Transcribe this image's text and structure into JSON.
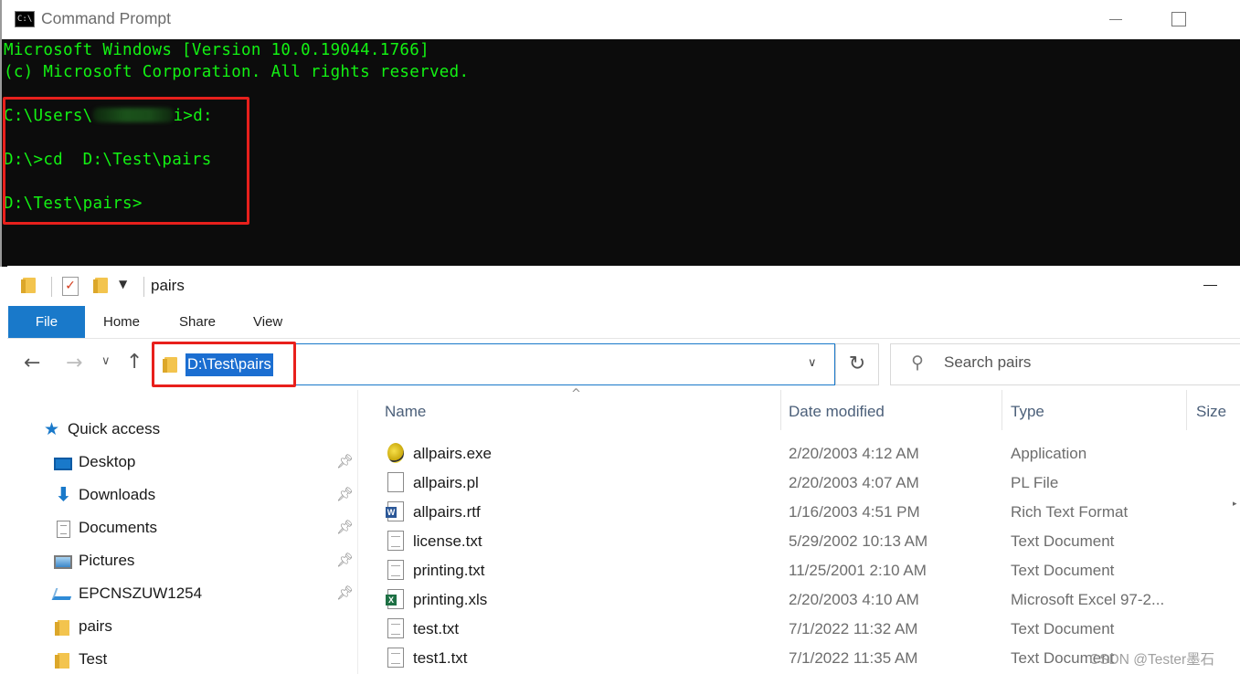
{
  "cmd": {
    "title": "Command Prompt",
    "lines": [
      "Microsoft Windows [Version 10.0.19044.1766]",
      "(c) Microsoft Corporation. All rights reserved."
    ],
    "prompt1_prefix": "C:\\Users\\",
    "prompt1_suffix": "i>d:",
    "prompt2": "D:\\>cd  D:\\Test\\pairs",
    "prompt3": "D:\\Test\\pairs>",
    "text_color": "#13f213",
    "highlight_color": "#e8201c"
  },
  "explorer": {
    "title": "pairs",
    "ribbon_tabs": [
      "File",
      "Home",
      "Share",
      "View"
    ],
    "address": "D:\\Test\\pairs",
    "search_placeholder": "Search pairs",
    "nav": {
      "quick_access": "Quick access",
      "items": [
        {
          "label": "Desktop",
          "icon": "desktop-icon",
          "pinned": true
        },
        {
          "label": "Downloads",
          "icon": "download-icon",
          "pinned": true
        },
        {
          "label": "Documents",
          "icon": "documents-icon",
          "pinned": true
        },
        {
          "label": "Pictures",
          "icon": "pictures-icon",
          "pinned": true
        },
        {
          "label": "EPCNSZUW1254",
          "icon": "computer-icon",
          "pinned": true
        },
        {
          "label": "pairs",
          "icon": "folder-icon",
          "pinned": false
        },
        {
          "label": "Test",
          "icon": "folder-icon",
          "pinned": false
        }
      ]
    },
    "columns": [
      "Name",
      "Date modified",
      "Type",
      "Size"
    ],
    "files": [
      {
        "name": "allpairs.exe",
        "date": "2/20/2003 4:12 AM",
        "type": "Application",
        "icon": "exe-icon"
      },
      {
        "name": "allpairs.pl",
        "date": "2/20/2003 4:07 AM",
        "type": "PL File",
        "icon": "file-icon"
      },
      {
        "name": "allpairs.rtf",
        "date": "1/16/2003 4:51 PM",
        "type": "Rich Text Format",
        "icon": "word-icon"
      },
      {
        "name": "license.txt",
        "date": "5/29/2002 10:13 AM",
        "type": "Text Document",
        "icon": "text-file-icon"
      },
      {
        "name": "printing.txt",
        "date": "11/25/2001 2:10 AM",
        "type": "Text Document",
        "icon": "text-file-icon"
      },
      {
        "name": "printing.xls",
        "date": "2/20/2003 4:10 AM",
        "type": "Microsoft Excel 97-2...",
        "icon": "excel-icon"
      },
      {
        "name": "test.txt",
        "date": "7/1/2022 11:32 AM",
        "type": "Text Document",
        "icon": "text-file-icon"
      },
      {
        "name": "test1.txt",
        "date": "7/1/2022 11:35 AM",
        "type": "Text Document",
        "icon": "text-file-icon"
      }
    ],
    "accent_color": "#1979ca"
  },
  "watermark": "CSDN @Tester墨石"
}
